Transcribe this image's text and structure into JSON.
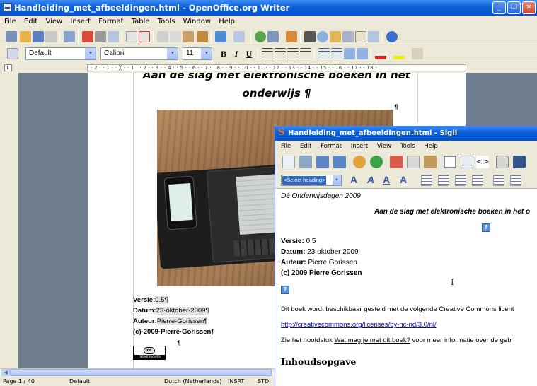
{
  "writer": {
    "title": "Handleiding_met_afbeeldingen.html - OpenOffice.org Writer",
    "menu": [
      "File",
      "Edit",
      "View",
      "Insert",
      "Format",
      "Table",
      "Tools",
      "Window",
      "Help"
    ],
    "style_combo": "Default",
    "font_combo": "Calibri",
    "size_combo": "11",
    "format_buttons": [
      "B",
      "I",
      "U"
    ],
    "ruler_text": "· 2 · · 1 · · ╳ · · 1 · · 2 · · 3 · · 4 · · 5 · · 6 · · 7 · · 8 · · 9 · · 10 · · 11 · · 12 · · 13 · · 14 · · 15 · · 16 · · 17 · · 18 ·",
    "doc": {
      "heading_line1": "Aan de slag met elektronische boeken in het",
      "heading_line2": "onderwijs ¶",
      "versie_label": "Versie:",
      "versie_value": "0.5¶",
      "datum_label": "Datum:",
      "datum_value": "23·oktober·2009¶",
      "auteur_label": "Auteur:",
      "auteur_value": "Pierre·Gorissen¶",
      "copyright": "(c)·2009·Pierre·Gorissen¶",
      "cc_logo": "cc",
      "cc_text": "SOME RIGHTS RESERVED",
      "pilcrow": "¶"
    },
    "status": {
      "page": "Page 1 / 40",
      "style": "Default",
      "language": "Dutch (Netherlands)",
      "insert": "INSRT",
      "std": "STD"
    }
  },
  "sigil": {
    "title": "Handleiding_met_afbeeldingen.html - Sigil",
    "menu": [
      "File",
      "Edit",
      "Format",
      "Insert",
      "View",
      "Tools",
      "Help"
    ],
    "heading_combo": "<Select heading>",
    "body": {
      "line1": "Dé Onderwijsdagen 2009",
      "heading": "Aan de slag met elektronische boeken in het o",
      "versie_label": "Versie:",
      "versie_value": "0.5",
      "datum_label": "Datum:",
      "datum_value": "23 oktober 2009",
      "auteur_label": "Auteur:",
      "auteur_value": "Pierre Gorissen",
      "copyright": "(c) 2009 Pierre Gorissen",
      "cc_para": "Dit boek wordt beschikbaar gesteld met de volgende Creative Commons licent",
      "link": "http://creativecommons.org/licenses/by-nc-nd/3.0/nl/",
      "zie_pre": "Zie het hoofdstuk ",
      "zie_link": "Wat mag je met dit boek?",
      "zie_post": " voor meer informatie over de gebr",
      "inhoud": "Inhoudsopgave",
      "image_placeholder": "?"
    }
  }
}
